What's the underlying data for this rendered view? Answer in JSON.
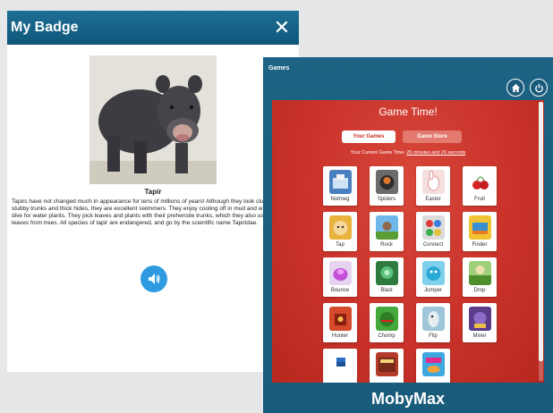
{
  "badge_window": {
    "title": "My Badge",
    "close_glyph": "✕",
    "animal_name": "Tapir",
    "description": "Tapirs have not changed much in appearance for tens of millions of years! Although they look clumsy with their stubby trunks and thick hides, they are excellent swimmers. They enjoy cooling off in mud and water, and can even dive for water plants. They pick leaves and plants with their prehensile trunks, which they also use to pluck fruit and leaves from trees. All species of tapir are endangered, and go by the scientific name Tapiridae.",
    "icons": {
      "close": "close-icon",
      "sound": "speaker-icon"
    }
  },
  "moby_window": {
    "topbar_title": "Games",
    "icons": {
      "home": "home-icon",
      "power": "power-icon"
    },
    "panel_title": "Game Time!",
    "tabs": [
      {
        "label": "Your Games",
        "active": true
      },
      {
        "label": "Game Store",
        "active": false
      }
    ],
    "game_time_prefix": "Your Current Game Time:",
    "game_time_value": "25 minutes and 26 seconds",
    "brand": "MobyMax",
    "colors": {
      "header_blue": "#1c6384",
      "panel_red": "#c9322a",
      "accent_blue": "#2e9be0"
    },
    "games": [
      {
        "label": "Nutmeg"
      },
      {
        "label": "Spiders"
      },
      {
        "label": "Easter"
      },
      {
        "label": "Fruit"
      },
      {
        "label": "Tap"
      },
      {
        "label": "Rock"
      },
      {
        "label": "Connect"
      },
      {
        "label": "Finder"
      },
      {
        "label": "Bounce"
      },
      {
        "label": "Blast"
      },
      {
        "label": "Jumper"
      },
      {
        "label": "Drop"
      },
      {
        "label": "Hunter"
      },
      {
        "label": "Chomp"
      },
      {
        "label": "Flip"
      },
      {
        "label": "Miner"
      },
      {
        "label": ""
      },
      {
        "label": ""
      },
      {
        "label": ""
      }
    ]
  }
}
